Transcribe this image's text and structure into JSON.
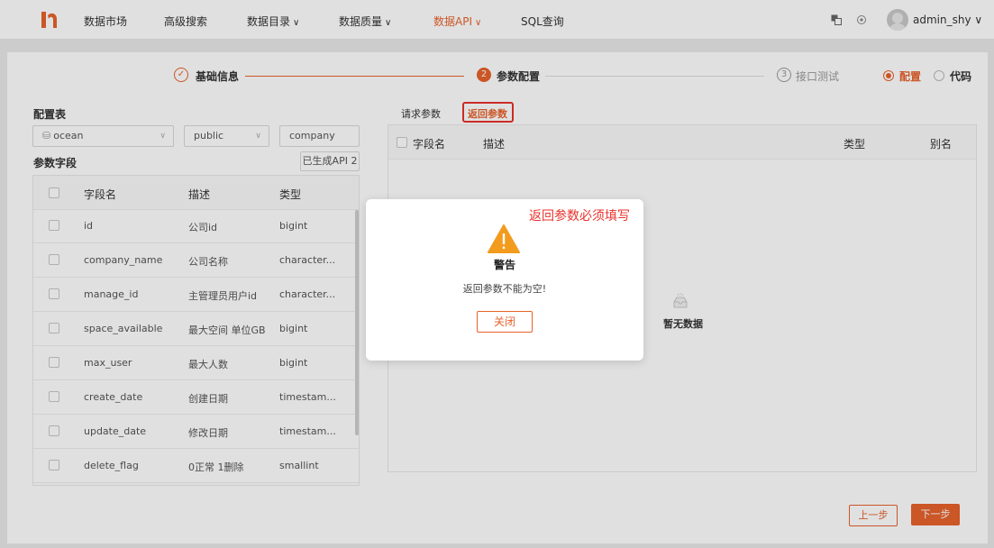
{
  "nav": {
    "items": [
      {
        "label": "数据市场",
        "caret": ""
      },
      {
        "label": "高级搜索",
        "caret": ""
      },
      {
        "label": "数据目录",
        "caret": "∨"
      },
      {
        "label": "数据质量",
        "caret": "∨"
      },
      {
        "label": "数据API",
        "caret": "∨"
      },
      {
        "label": "SQL查询",
        "caret": ""
      }
    ],
    "active_index": 4,
    "user": "admin_shy ∨",
    "accent": "#e8622c"
  },
  "steps": [
    {
      "num": "✓",
      "label": "基础信息",
      "state": "done"
    },
    {
      "num": "2",
      "label": "参数配置",
      "state": "current"
    },
    {
      "num": "3",
      "label": "接口测试",
      "state": "pending"
    }
  ],
  "mode": {
    "config_label": "配置",
    "code_label": "代码",
    "selected": "配置"
  },
  "left": {
    "config_title": "配置表",
    "datasource": "ocean",
    "schema": "public",
    "table": "company",
    "fields_title": "参数字段",
    "generated_label": "已生成API 2",
    "columns": [
      "字段名",
      "描述",
      "类型"
    ],
    "rows": [
      {
        "name": "id",
        "desc": "公司id",
        "type": "bigint"
      },
      {
        "name": "company_name",
        "desc": "公司名称",
        "type": "character..."
      },
      {
        "name": "manage_id",
        "desc": "主管理员用户id",
        "type": "character..."
      },
      {
        "name": "space_available",
        "desc": "最大空间 单位GB",
        "type": "bigint"
      },
      {
        "name": "max_user",
        "desc": "最大人数",
        "type": "bigint"
      },
      {
        "name": "create_date",
        "desc": "创建日期",
        "type": "timestam..."
      },
      {
        "name": "update_date",
        "desc": "修改日期",
        "type": "timestam..."
      },
      {
        "name": "delete_flag",
        "desc": "0正常 1删除",
        "type": "smallint"
      }
    ]
  },
  "right": {
    "tabs": [
      "请求参数",
      "返回参数"
    ],
    "active_tab": "返回参数",
    "columns": [
      "字段名",
      "描述",
      "类型",
      "别名"
    ],
    "empty_text": "暂无数据"
  },
  "footer": {
    "prev": "上一步",
    "next": "下一步"
  },
  "modal": {
    "annotation": "返回参数必须填写",
    "title": "警告",
    "message": "返回参数不能为空!",
    "close": "关闭",
    "warn_color": "#f29b1d"
  }
}
